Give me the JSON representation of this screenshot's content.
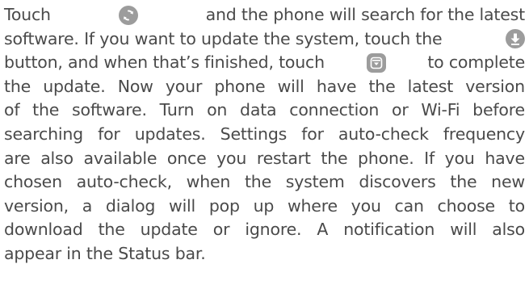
{
  "paragraph": {
    "line1": {
      "a": "Touch",
      "icon": "refresh-icon",
      "b": "and the phone will search for the latest"
    },
    "line2": {
      "a": "software. If you want to update the system, touch the",
      "icon": "download-icon"
    },
    "line3": {
      "a": "button, and when that’s finished, touch",
      "icon": "install-update-icon",
      "b": "to complete"
    },
    "line4": "the update. Now your phone will have the latest version",
    "line5": "of the software. Turn on data connection or Wi-Fi before",
    "line6": "searching for updates. Settings for auto-check frequency",
    "line7": "are also available once you restart the phone. If you have",
    "line8": "chosen auto-check, when the system discovers the new",
    "line9": "version, a dialog will pop up where you can choose to",
    "line10": "download the update or ignore. A notification will also",
    "line11": "appear in the Status bar."
  },
  "colors": {
    "text": "#4a4a4a",
    "icon": "#9c9c9c"
  }
}
